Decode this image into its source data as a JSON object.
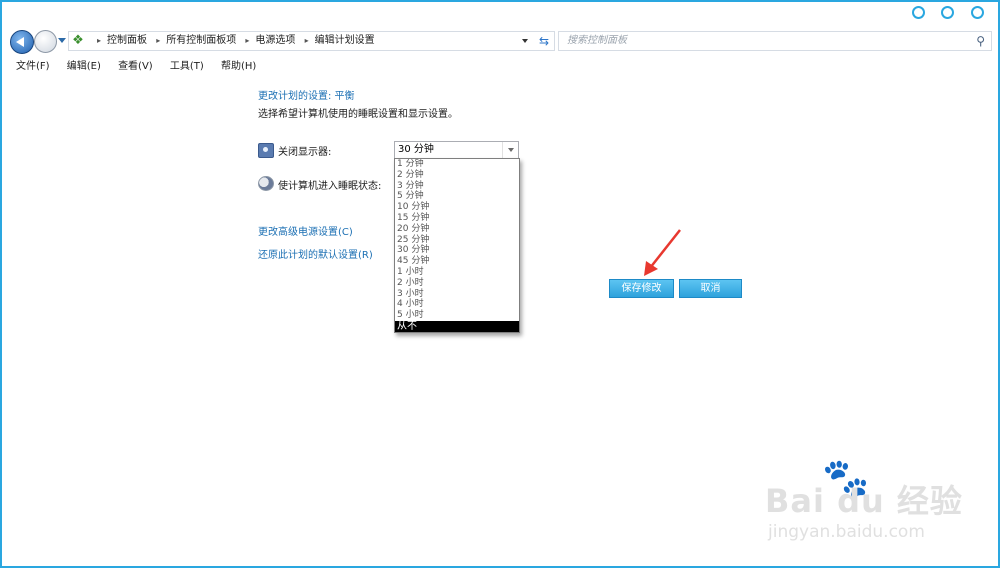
{
  "window": {
    "controls": [
      "min-circle",
      "max-circle",
      "close-circle"
    ]
  },
  "address_bar": {
    "breadcrumbs": [
      "控制面板",
      "所有控制面板项",
      "电源选项",
      "编辑计划设置"
    ]
  },
  "search": {
    "placeholder": "搜索控制面板"
  },
  "menu": {
    "file": "文件(F)",
    "edit": "编辑(E)",
    "view": "查看(V)",
    "tools": "工具(T)",
    "help": "帮助(H)"
  },
  "content": {
    "title": "更改计划的设置: 平衡",
    "description": "选择希望计算机使用的睡眠设置和显示设置。",
    "display_label": "关闭显示器:",
    "sleep_label": "使计算机进入睡眠状态:",
    "display_value": "30 分钟",
    "advanced_link": "更改高级电源设置(C)",
    "restore_link": "还原此计划的默认设置(R)"
  },
  "dropdown": {
    "options": [
      "1 分钟",
      "2 分钟",
      "3 分钟",
      "5 分钟",
      "10 分钟",
      "15 分钟",
      "20 分钟",
      "25 分钟",
      "30 分钟",
      "45 分钟",
      "1 小时",
      "2 小时",
      "3 小时",
      "4 小时",
      "5 小时",
      "从不"
    ],
    "selected": "从不"
  },
  "buttons": {
    "save": "保存修改",
    "cancel": "取消"
  },
  "watermark": {
    "brand": "Bai du 经验",
    "url": "jingyan.baidu.com"
  },
  "colors": {
    "accent": "#2aa7e0",
    "link": "#1b6fb3",
    "button": "#2ea2dc",
    "annotation_arrow": "#e8382f"
  }
}
